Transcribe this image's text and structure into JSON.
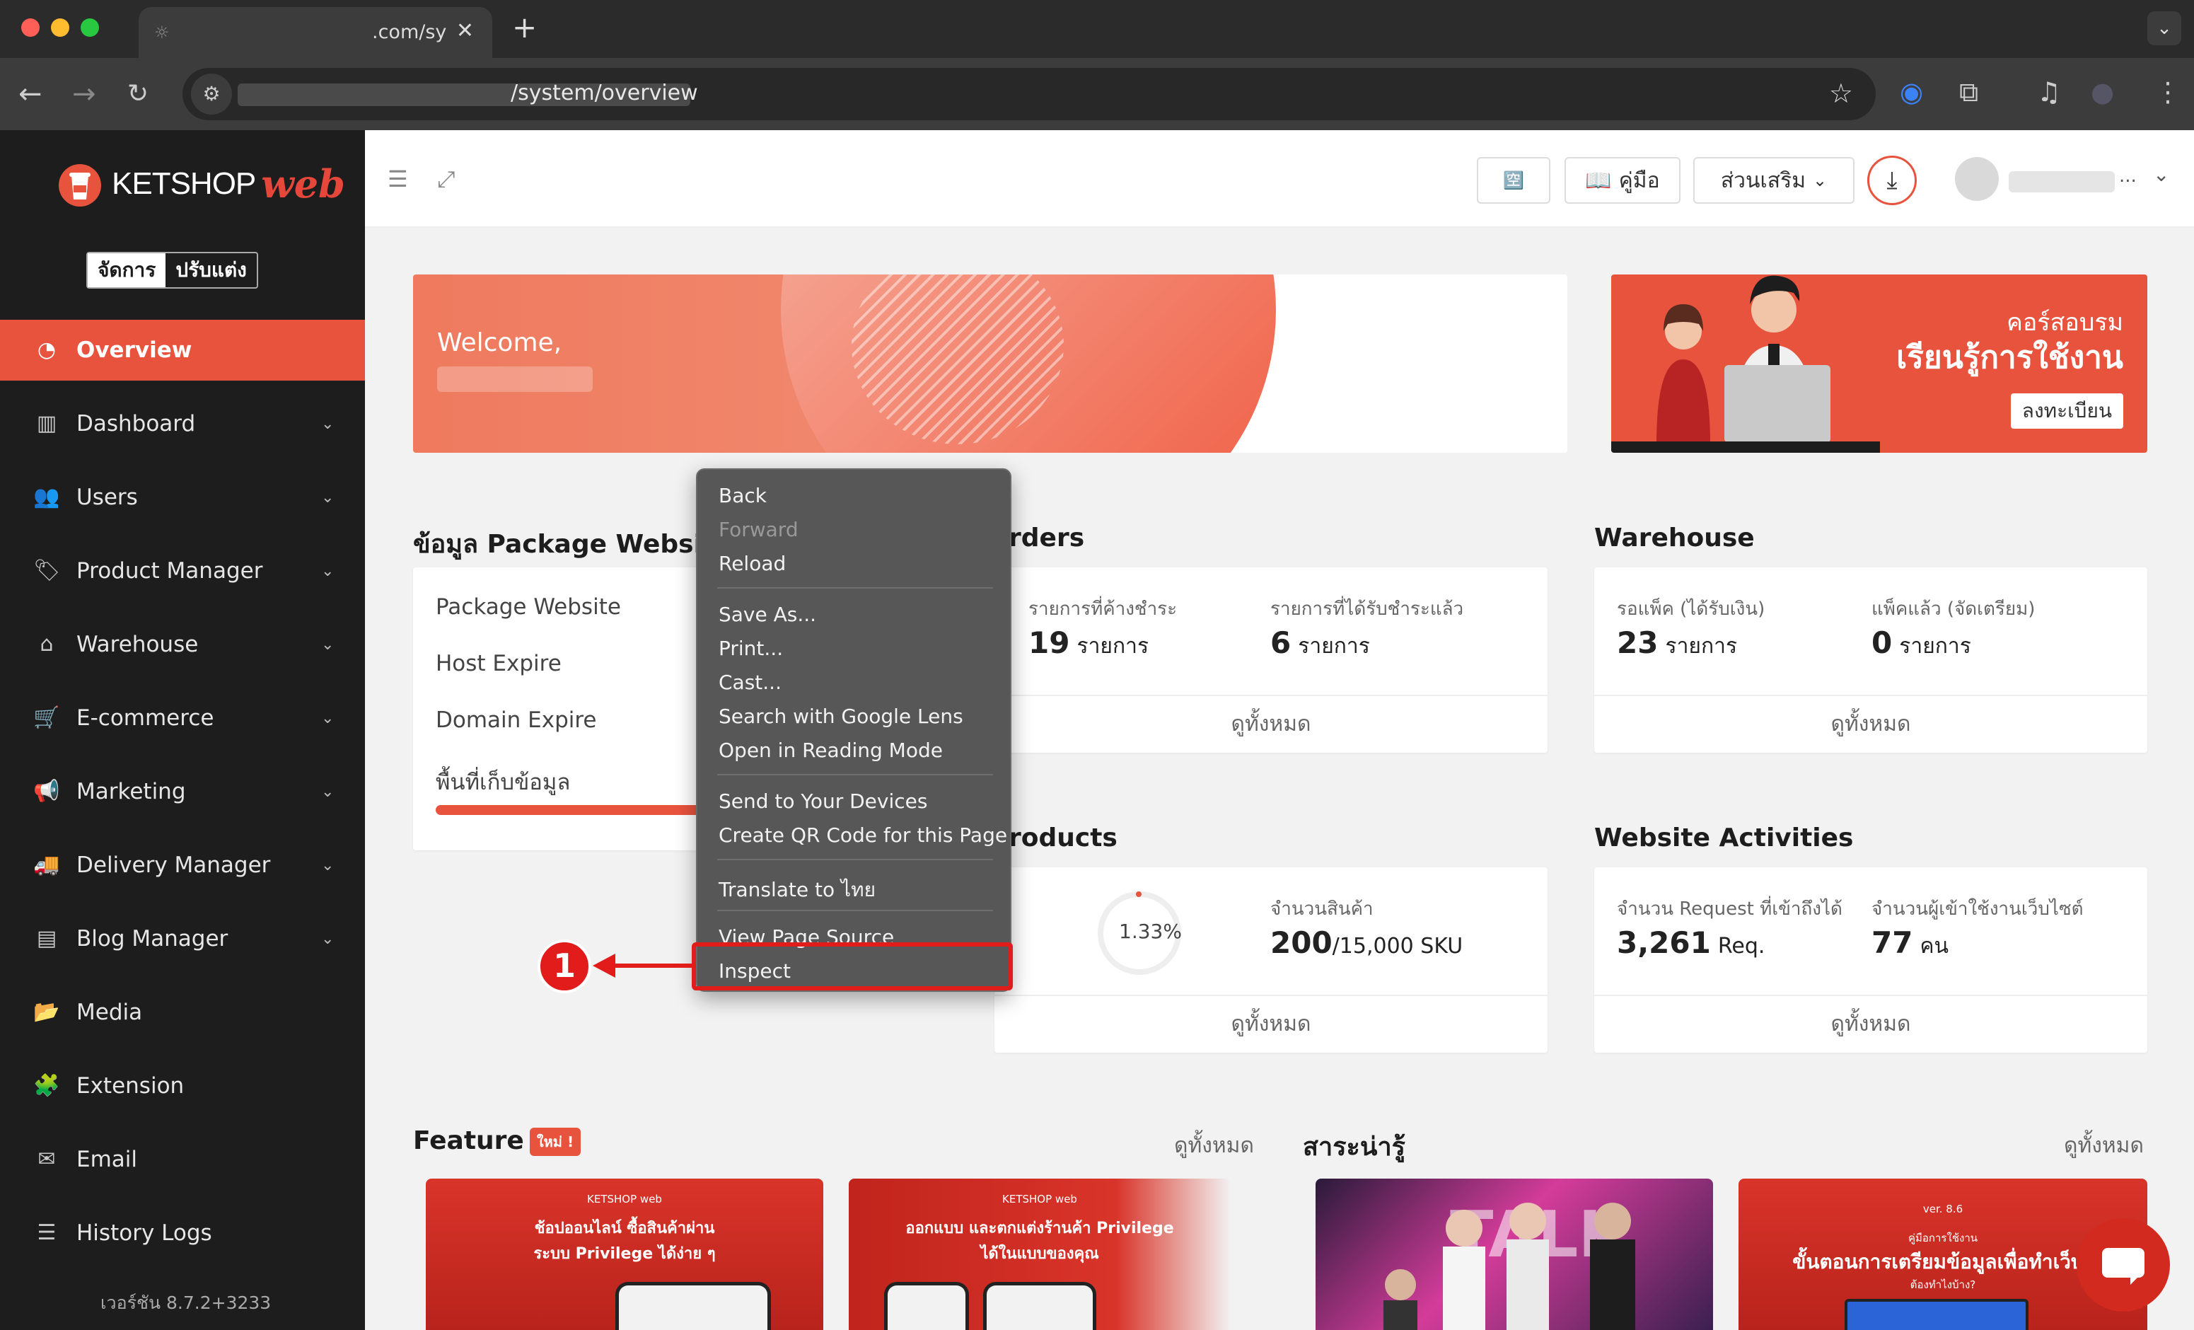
{
  "browser": {
    "tab_title": ".com/sy",
    "tab_close": "✕",
    "new_tab": "+",
    "tab_menu": "⌄",
    "url_path": "/system/overview"
  },
  "sidebar": {
    "logo_ket": "KETSHOP",
    "logo_web": "web",
    "mode_active": "จัดการ",
    "mode_inactive": "ปรับแต่ง",
    "items": [
      {
        "label": "Overview",
        "icon": "pie-chart-icon"
      },
      {
        "label": "Dashboard",
        "icon": "bar-chart-icon"
      },
      {
        "label": "Users",
        "icon": "users-icon"
      },
      {
        "label": "Product Manager",
        "icon": "tag-icon"
      },
      {
        "label": "Warehouse",
        "icon": "warehouse-icon"
      },
      {
        "label": "E-commerce",
        "icon": "cart-icon"
      },
      {
        "label": "Marketing",
        "icon": "megaphone-icon"
      },
      {
        "label": "Delivery Manager",
        "icon": "truck-icon"
      },
      {
        "label": "Blog Manager",
        "icon": "newspaper-icon"
      },
      {
        "label": "Media",
        "icon": "folder-icon"
      },
      {
        "label": "Extension",
        "icon": "puzzle-icon"
      },
      {
        "label": "Email",
        "icon": "envelope-icon"
      },
      {
        "label": "History Logs",
        "icon": "list-icon"
      }
    ],
    "version": "เวอร์ชัน 8.7.2+3233"
  },
  "topbar": {
    "manual_label": "คู่มือ",
    "addons_label": "ส่วนเสริม",
    "user_more": "..."
  },
  "welcome": {
    "text": "Welcome,"
  },
  "course_banner": {
    "line1": "คอร์สอบรม",
    "line2": "เรียนรู้การใช้งาน",
    "register": "ลงทะเบียน"
  },
  "package": {
    "title": "ข้อมูล Package Website",
    "rows": [
      "Package Website",
      "Host Expire",
      "Domain Expire",
      "พื้นที่เก็บข้อมูล"
    ]
  },
  "orders": {
    "title": "rders",
    "pending_label": "รายการที่ค้างชำระ",
    "pending_value": "19",
    "paid_label": "รายการที่ได้รับชำระแล้ว",
    "paid_value": "6",
    "unit": "รายการ",
    "view_all": "ดูทั้งหมด"
  },
  "warehouse": {
    "title": "Warehouse",
    "waiting_label": "รอแพ็ค (ได้รับเงิน)",
    "waiting_value": "23",
    "packed_label": "แพ็คแล้ว (จัดเตรียม)",
    "packed_value": "0",
    "unit": "รายการ",
    "view_all": "ดูทั้งหมด"
  },
  "products": {
    "title": "roducts",
    "percent": "1.33%",
    "count_label": "จำนวนสินค้า",
    "count_value": "200",
    "count_limit": "/15,000 SKU",
    "view_all": "ดูทั้งหมด"
  },
  "activities": {
    "title": "Website Activities",
    "requests_label": "จำนวน Request ที่เข้าถึงได้",
    "requests_value": "3,261",
    "requests_unit": "Req.",
    "visitors_label": "จำนวนผู้เข้าใช้งานเว็บไซต์",
    "visitors_value": "77",
    "visitors_unit": "คน",
    "view_all": "ดูทั้งหมด"
  },
  "feature": {
    "title": "Feature",
    "badge": "ใหม่ !",
    "view_all": "ดูทั้งหมด",
    "card1_logo": "KETSHOP web",
    "card1_line1": "ช้อปออนไลน์ ซื้อสินค้าผ่าน",
    "card1_line2": "ระบบ Privilege ได้ง่าย ๆ",
    "card2_logo": "KETSHOP web",
    "card2_line1": "ออกแบบ และตกแต่งร้านค้า Privilege",
    "card2_line2": "ได้ในแบบของคุณ"
  },
  "news": {
    "title": "สาระน่ารู้",
    "view_all": "ดูทั้งหมด",
    "card2_ver": "ver. 8.6",
    "card2_sub": "คู่มือการใช้งาน",
    "card2_title": "ขั้นตอนการเตรียมข้อมูลเพื่อทำเว็บไ",
    "card2_q": "ต้องทำไงบ้าง?"
  },
  "context_menu": {
    "items": [
      {
        "label": "Back",
        "disabled": false
      },
      {
        "label": "Forward",
        "disabled": true
      },
      {
        "label": "Reload",
        "disabled": false
      },
      {
        "label": "Save As...",
        "disabled": false
      },
      {
        "label": "Print...",
        "disabled": false
      },
      {
        "label": "Cast...",
        "disabled": false
      },
      {
        "label": "Search with Google Lens",
        "disabled": false
      },
      {
        "label": "Open in Reading Mode",
        "disabled": false
      },
      {
        "label": "Send to Your Devices",
        "disabled": false
      },
      {
        "label": "Create QR Code for this Page",
        "disabled": false
      },
      {
        "label": "Translate to ไทย",
        "disabled": false
      },
      {
        "label": "View Page Source",
        "disabled": false
      },
      {
        "label": "Inspect",
        "disabled": false
      }
    ]
  },
  "annotation": {
    "step_number": "1",
    "color": "#e21b1b"
  },
  "colors": {
    "accent": "#e8533e",
    "sidebar_bg": "#1d1d1d"
  }
}
